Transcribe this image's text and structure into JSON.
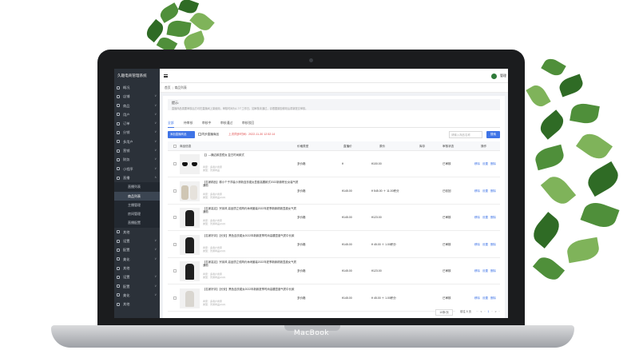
{
  "device": {
    "brand": "MacBook"
  },
  "app": {
    "title": "久趣电商管理系统",
    "user": "管理"
  },
  "sidebar": {
    "items": [
      {
        "label": "概况",
        "arrow": ""
      },
      {
        "label": "店铺",
        "arrow": "∨"
      },
      {
        "label": "商品",
        "arrow": "∨"
      },
      {
        "label": "用户",
        "arrow": "∨"
      },
      {
        "label": "订单",
        "arrow": "∨"
      },
      {
        "label": "分销",
        "arrow": "∨"
      },
      {
        "label": "多用户",
        "arrow": "∨"
      },
      {
        "label": "营销",
        "arrow": "∨"
      },
      {
        "label": "财务",
        "arrow": "∨"
      },
      {
        "label": "小程序",
        "arrow": "∨"
      },
      {
        "label": "直播",
        "arrow": "∧"
      }
    ],
    "sub": [
      "直播列表",
      "商品列表",
      "主播管理",
      "房间管理",
      "直播配置"
    ],
    "bottom": [
      {
        "label": "其他",
        "arrow": ""
      },
      {
        "label": "设置",
        "arrow": "∨"
      },
      {
        "label": "配置",
        "arrow": "∨"
      },
      {
        "label": "美化",
        "arrow": "∨"
      },
      {
        "label": "其他",
        "arrow": ""
      },
      {
        "label": "设置",
        "arrow": "∨"
      },
      {
        "label": "配置",
        "arrow": "∨"
      },
      {
        "label": "美化",
        "arrow": "∨"
      },
      {
        "label": "其他",
        "arrow": ""
      }
    ]
  },
  "breadcrumb": {
    "home": "首页",
    "current": "商品列表"
  },
  "tip": {
    "title": "提示:",
    "text": "直播商品需要审核后方可在直播间上架使用，审核时间为1-7个工作日，如审核未通过，请根据原因修改后重新提交审核。"
  },
  "tabs": [
    "全部",
    "待审核",
    "审核中",
    "审核通过",
    "审核驳回"
  ],
  "toolbar": {
    "add_button": "添加直播商品",
    "sync_label": "同步直播商品",
    "timer": "上次同步时间：2022-11-30 12:52:14",
    "search_placeholder": "请输入商品名称",
    "search_button": "搜索"
  },
  "table": {
    "headers": [
      "商品信息",
      "价格类型",
      "直播价",
      "原价",
      "库存",
      "审核状态",
      "操作"
    ],
    "rows": [
      {
        "name": "【】—横边款墨镜女 复古时尚款式",
        "meta1": "商家：多用户商家",
        "meta2": "类型：普通商品",
        "price_type": "多价格",
        "live_price": "¥",
        "orig_price": "¥100.00",
        "stock": "",
        "status": "已审核",
        "thumb": "glasses"
      },
      {
        "name": "【名家精品】棉小个子洋装小清新连衣裙女显瘦高腰款式2022新款职业女装气质通勤",
        "meta1": "商家：多用户商家",
        "meta2": "类型：普通商品(2)(2)",
        "price_type": "多价格",
        "live_price": "¥145.00",
        "orig_price": "¥ 545.00 ＋ 11.00积分",
        "stock": "",
        "status": "已驳回",
        "thumb": "duo"
      },
      {
        "name": "【名家高定】宗亲风 高品质立领简约休闲套装2022年夏季新款精致显瘦女气质通勤",
        "meta1": "商家：多用户商家",
        "meta2": "类型：普通商品(2)(2)",
        "price_type": "多价格",
        "live_price": "¥145.00",
        "orig_price": "¥123.00",
        "stock": "",
        "status": "已审核",
        "thumb": "dark"
      },
      {
        "name": "【名家好评】【长安】黑色连衣裙女2022年新款夏季时尚高腰显瘦气质中长款",
        "meta1": "商家：多用户商家",
        "meta2": "类型：普通商品(2)(2)",
        "price_type": "多价格",
        "live_price": "¥145.00",
        "orig_price": "¥ 45.00 ＋ 1.00积分",
        "stock": "",
        "status": "已审核",
        "thumb": "dark"
      },
      {
        "name": "【名家高定】宗亲风 高品质立领简约休闲套装2022年夏季新款精致显瘦女气质通勤",
        "meta1": "商家：多用户商家",
        "meta2": "类型：普通商品(2)(2)",
        "price_type": "多价格",
        "live_price": "¥145.00",
        "orig_price": "¥123.00",
        "stock": "",
        "status": "已审核",
        "thumb": "dark"
      },
      {
        "name": "【名家好评】【长安】黑色连衣裙女2022年新款夏季时尚高腰显瘦气质中长款",
        "meta1": "商家：多用户商家",
        "meta2": "类型：普通商品(2)(2)",
        "price_type": "多价格",
        "live_price": "¥145.00",
        "orig_price": "¥ 45.00 ＋ 1.00积分",
        "stock": "",
        "status": "已审核",
        "thumb": "light"
      }
    ],
    "actions": [
      "移除",
      "设置",
      "删除"
    ]
  },
  "pager": {
    "total": "10条/页",
    "size": "前往 5 页",
    "prev": "<",
    "page": "1",
    "next": ">"
  }
}
